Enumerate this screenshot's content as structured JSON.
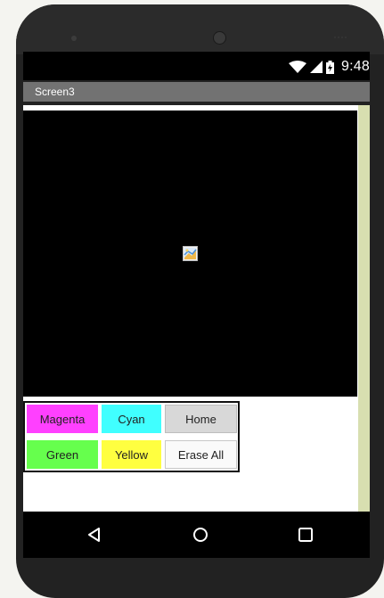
{
  "status_bar": {
    "time": "9:48",
    "icons": [
      "wifi-icon",
      "cell-signal-icon",
      "battery-icon"
    ]
  },
  "app": {
    "title": "Screen3",
    "canvas_image_icon": "broken-image-icon",
    "buttons": {
      "magenta": {
        "label": "Magenta",
        "color": "#ff40ff"
      },
      "cyan": {
        "label": "Cyan",
        "color": "#40ffff"
      },
      "home": {
        "label": "Home",
        "color": "#d8d8d8"
      },
      "green": {
        "label": "Green",
        "color": "#66ff4d"
      },
      "yellow": {
        "label": "Yellow",
        "color": "#ffff40"
      },
      "erase_all": {
        "label": "Erase All",
        "color": "#fafafa"
      }
    }
  },
  "nav_bar": {
    "icons": [
      "back-triangle-icon",
      "home-circle-icon",
      "recent-apps-square-icon"
    ]
  },
  "colors": {
    "title_bar": "#727272",
    "canvas": "#000000",
    "side_strip": "#d8dfb0"
  }
}
